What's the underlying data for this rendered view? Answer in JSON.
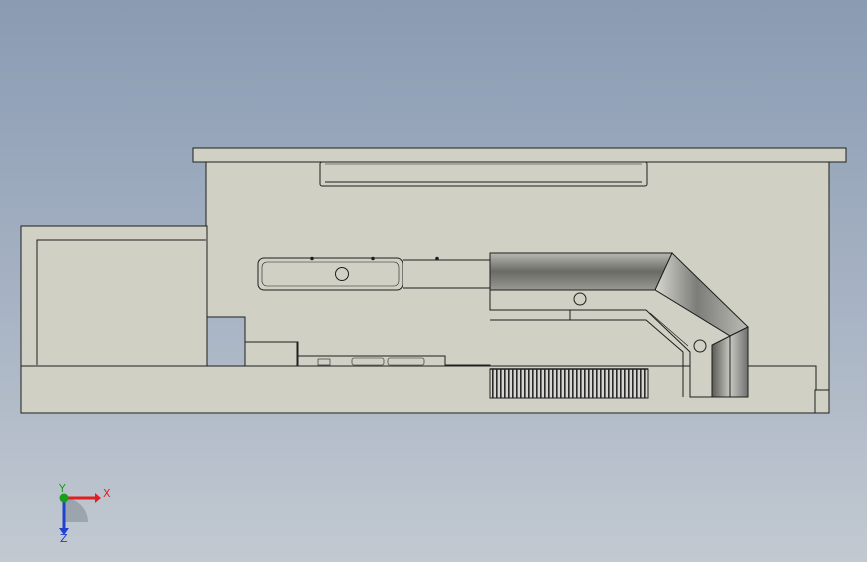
{
  "view": {
    "background_top": "#8a9bb2",
    "background_bottom": "#c2c9d1",
    "part_fill": "#d1d0c4",
    "edge_color": "#1f1f1f"
  },
  "triad": {
    "x_label": "X",
    "y_label": "Y",
    "z_label": "Z",
    "x_color": "#e02020",
    "y_color": "#18a018",
    "z_color": "#2040d0"
  }
}
